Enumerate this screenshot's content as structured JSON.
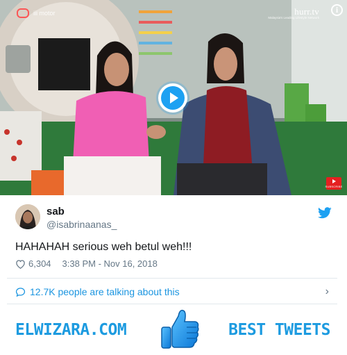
{
  "video": {
    "channel_logo_text": "hurr.tv",
    "channel_tagline": "Malaysia's Leading Lifestyle Network",
    "top_left_brand": "iii motor",
    "youtube_badge_text": "SUBSCRIBE"
  },
  "tweet": {
    "user_name": "sab",
    "user_handle": "@isabrinaanas_",
    "text": "HAHAHAH serious weh betul weh!!!",
    "likes": "6,304",
    "timestamp": "3:38 PM - Nov 16, 2018",
    "talking_about": "12.7K people are talking about this"
  },
  "footer": {
    "site_name": "ELWIZARA.COM",
    "best_tweets": "BEST TWEETS"
  },
  "colors": {
    "twitter_blue": "#1da1f2",
    "link_blue": "#1b95e0",
    "brand_blue": "#1d9be0",
    "text_dark": "#14171a",
    "text_gray": "#657786"
  }
}
